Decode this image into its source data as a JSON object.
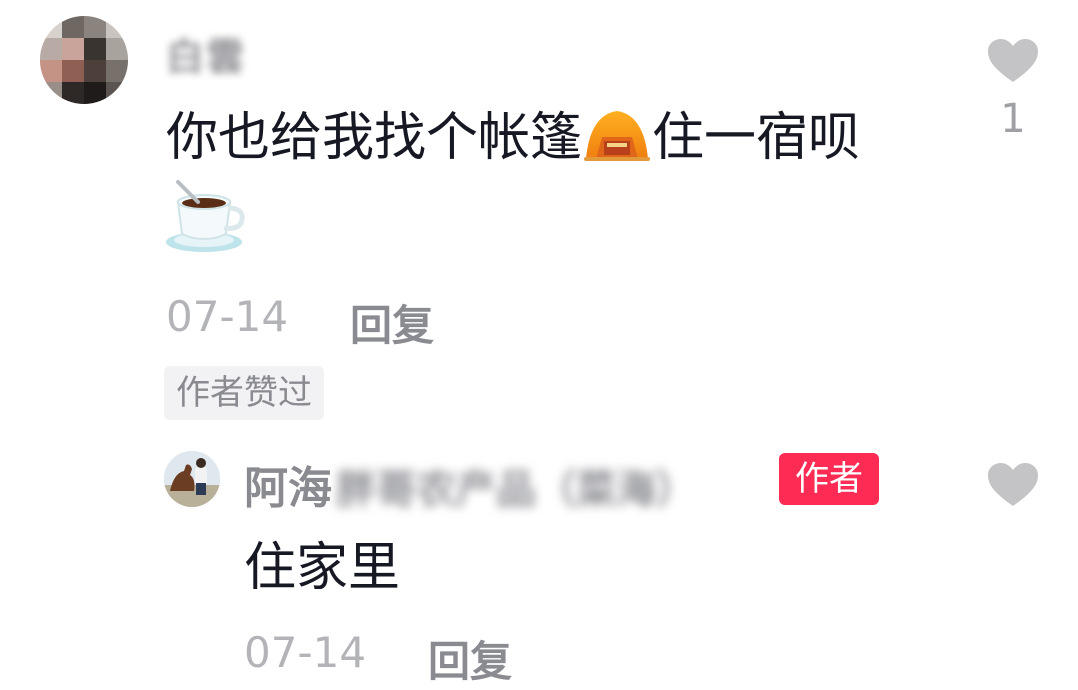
{
  "comment": {
    "username": "白雲",
    "text": "你也给我找个帐篷",
    "text_after_emoji": "住一宿呗",
    "emoji_inline": "tent-emoji",
    "emoji_trailing": "hot-beverage-emoji",
    "date": "07-14",
    "reply_label": "回复",
    "liked_by_author_label": "作者赞过",
    "like_count": "1",
    "icons": {
      "like": "heart-icon"
    }
  },
  "reply": {
    "username_prefix": "阿海",
    "username_rest_blurred": "胖哥农产品（菜海）",
    "author_badge": "作者",
    "text": "住家里",
    "date": "07-14",
    "reply_label": "回复",
    "icons": {
      "like": "heart-icon"
    }
  },
  "colors": {
    "author_badge_bg": "#fe2c55",
    "heart": "#c4c4c6",
    "meta_gray": "#b3b4b8",
    "reply_gray": "#8a8b91"
  }
}
